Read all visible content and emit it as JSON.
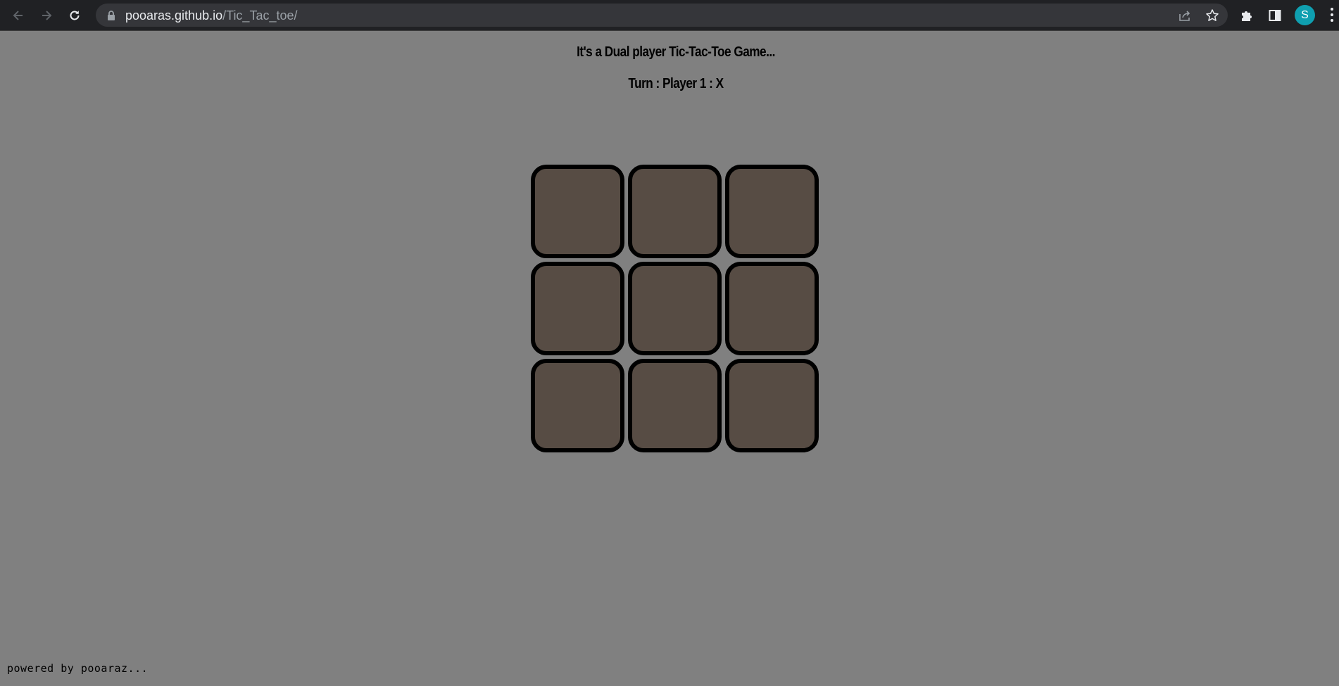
{
  "browser": {
    "url_host": "pooaras.github.io",
    "url_path": "/Tic_Tac_toe/",
    "profile_initial": "S",
    "icons": [
      "back-arrow-icon",
      "forward-arrow-icon",
      "reload-icon",
      "lock-icon",
      "share-icon",
      "bookmark-star-icon",
      "extensions-puzzle-icon",
      "side-panel-icon",
      "more-menu-icon"
    ],
    "accent_color": "#0f9fb0"
  },
  "page": {
    "title": "It's a Dual player Tic-Tac-Toe Game...",
    "turn_status": "Turn : Player 1 : X",
    "footer": "powered by pooaraz...",
    "background_color": "#808080",
    "cell_color": "#574c44"
  },
  "board": {
    "cells": [
      "",
      "",
      "",
      "",
      "",
      "",
      "",
      "",
      ""
    ]
  }
}
